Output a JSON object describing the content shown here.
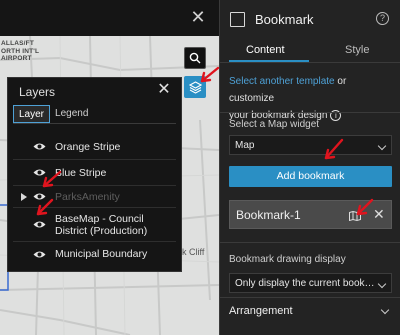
{
  "map": {
    "label_lines": [
      "ALLAS/FT",
      "ORTH INT'L",
      "AIRPORT"
    ],
    "place_label": "k Cliff",
    "close_icon": "close-icon",
    "search_icon": "search-icon",
    "layers_icon": "layers-icon"
  },
  "layers_panel": {
    "title": "Layers",
    "tabs": [
      {
        "label": "Layer",
        "active": true
      },
      {
        "label": "Legend",
        "active": false
      }
    ],
    "items": [
      {
        "label": "Orange Stripe",
        "visible": true
      },
      {
        "label": "Blue Stripe",
        "visible": true
      },
      {
        "label": "ParksAmenity",
        "visible": true,
        "dimmed": true,
        "expandable": true
      },
      {
        "label_lines": [
          "BaseMap - Council",
          "District (Production)"
        ],
        "visible": true
      },
      {
        "label": "Municipal Boundary",
        "visible": true
      }
    ]
  },
  "bookmark_panel": {
    "title": "Bookmark",
    "tabs": [
      "Content",
      "Style"
    ],
    "active_tab": "Content",
    "description": {
      "link": "Select another template",
      "line1_rest": " or customize",
      "line2": "your bookmark design"
    },
    "map_widget_label": "Select a Map widget",
    "map_widget_value": "Map",
    "add_button": "Add bookmark",
    "bookmarks": [
      "Bookmark-1"
    ],
    "drawing_display_label": "Bookmark drawing display",
    "drawing_display_value": "Only display the current book…",
    "arrangement_label": "Arrangement"
  },
  "colors": {
    "accent": "#2a8fc4",
    "annotation": "#e0141e"
  }
}
